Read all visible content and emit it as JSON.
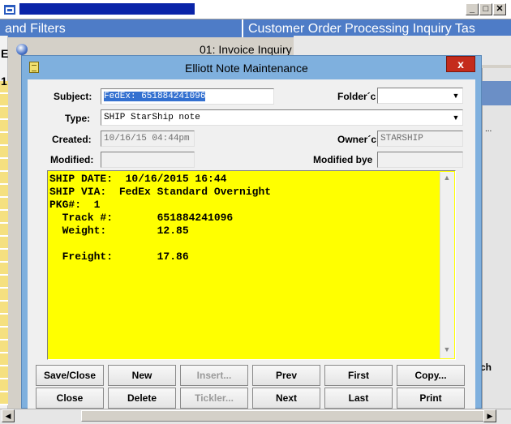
{
  "background": {
    "tab_text_left": "and Filters",
    "tab_text_right": "Customer Order Processing Inquiry Tas",
    "letter_e": "E",
    "letter_1": "1",
    "right_text_ch": "ch",
    "right_dots": "..."
  },
  "invoice_window": {
    "title": "01: Invoice Inquiry"
  },
  "dialog": {
    "title": "Elliott Note Maintenance",
    "close_label": "x",
    "labels": {
      "subject": "Subject:",
      "folder": "Folder´c",
      "type": "Type:",
      "created": "Created:",
      "owner": "Owner´c",
      "modified": "Modified:",
      "modified_by": "Modified bye"
    },
    "fields": {
      "subject": "FedEx:  651884241096",
      "folder": "",
      "type": "SHIP   StarShip note",
      "created": "10/16/15 04:44pm",
      "owner": "STARSHIP",
      "modified": "",
      "modified_by": ""
    },
    "note_text": "SHIP DATE:  10/16/2015 16:44\nSHIP VIA:  FedEx Standard Overnight\nPKG#:  1\n  Track #:       651884241096\n  Weight:        12.85\n\n  Freight:       17.86",
    "buttons_row1": [
      "Save/Close",
      "New",
      "Insert...",
      "Prev",
      "First",
      "Copy..."
    ],
    "buttons_row2": [
      "Close",
      "Delete",
      "Tickler...",
      "Next",
      "Last",
      "Print"
    ]
  },
  "icons": {
    "app": "app-icon",
    "dropdown": "chevron-down-icon",
    "note": "note-icon"
  }
}
